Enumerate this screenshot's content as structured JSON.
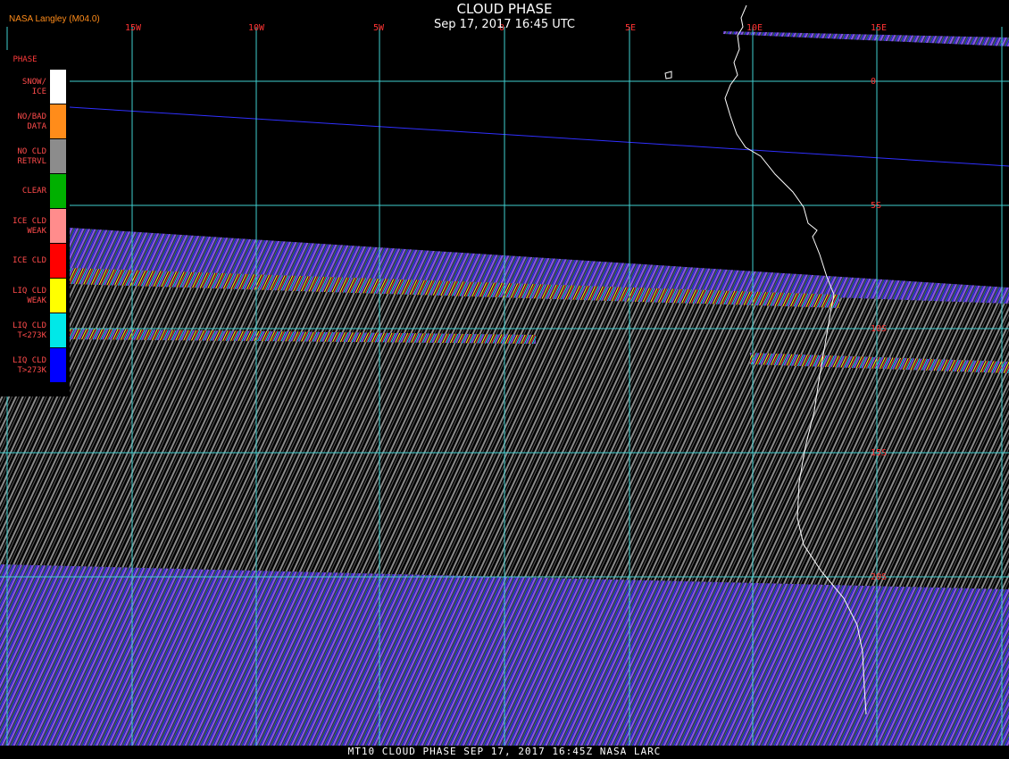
{
  "header": {
    "title": "CLOUD PHASE",
    "timestamp": "Sep 17, 2017 16:45 UTC",
    "producer": "NASA Langley (M04.0)"
  },
  "footer": {
    "text": "MT10  CLOUD PHASE   SEP 17, 2017 16:45Z   NASA LARC"
  },
  "legend": {
    "title": "PHASE",
    "items": [
      {
        "label": "SNOW/\nICE",
        "color": "#ffffff"
      },
      {
        "label": "NO/BAD\nDATA",
        "color": "#ff8c1a"
      },
      {
        "label": "NO CLD\nRETRVL",
        "color": "#8c8c8c"
      },
      {
        "label": "CLEAR",
        "color": "#00b000"
      },
      {
        "label": "ICE CLD\nWEAK",
        "color": "#ff8c8c"
      },
      {
        "label": "ICE CLD",
        "color": "#ff0000"
      },
      {
        "label": "LIQ CLD\nWEAK",
        "color": "#ffff00"
      },
      {
        "label": "LIQ CLD\nT<273K",
        "color": "#00e8e8"
      },
      {
        "label": "LIQ CLD\nT>273K",
        "color": "#0000ff"
      }
    ]
  },
  "grid": {
    "longitudes": [
      "15W",
      "10W",
      "5W",
      "0",
      "5E",
      "10E",
      "15E"
    ],
    "latitudes": [
      "0",
      "5S",
      "10S",
      "15S",
      "20S"
    ],
    "line_color": "#40d0d0",
    "label_color": "#ff3333"
  },
  "colors": {
    "background": "#000000",
    "coastline": "#ffffff",
    "scan_line": "#3030ff",
    "stripe_purple": "#6a3fbf",
    "stripe_blue": "#2a2adf",
    "stripe_gray": "#7a7a7a"
  }
}
